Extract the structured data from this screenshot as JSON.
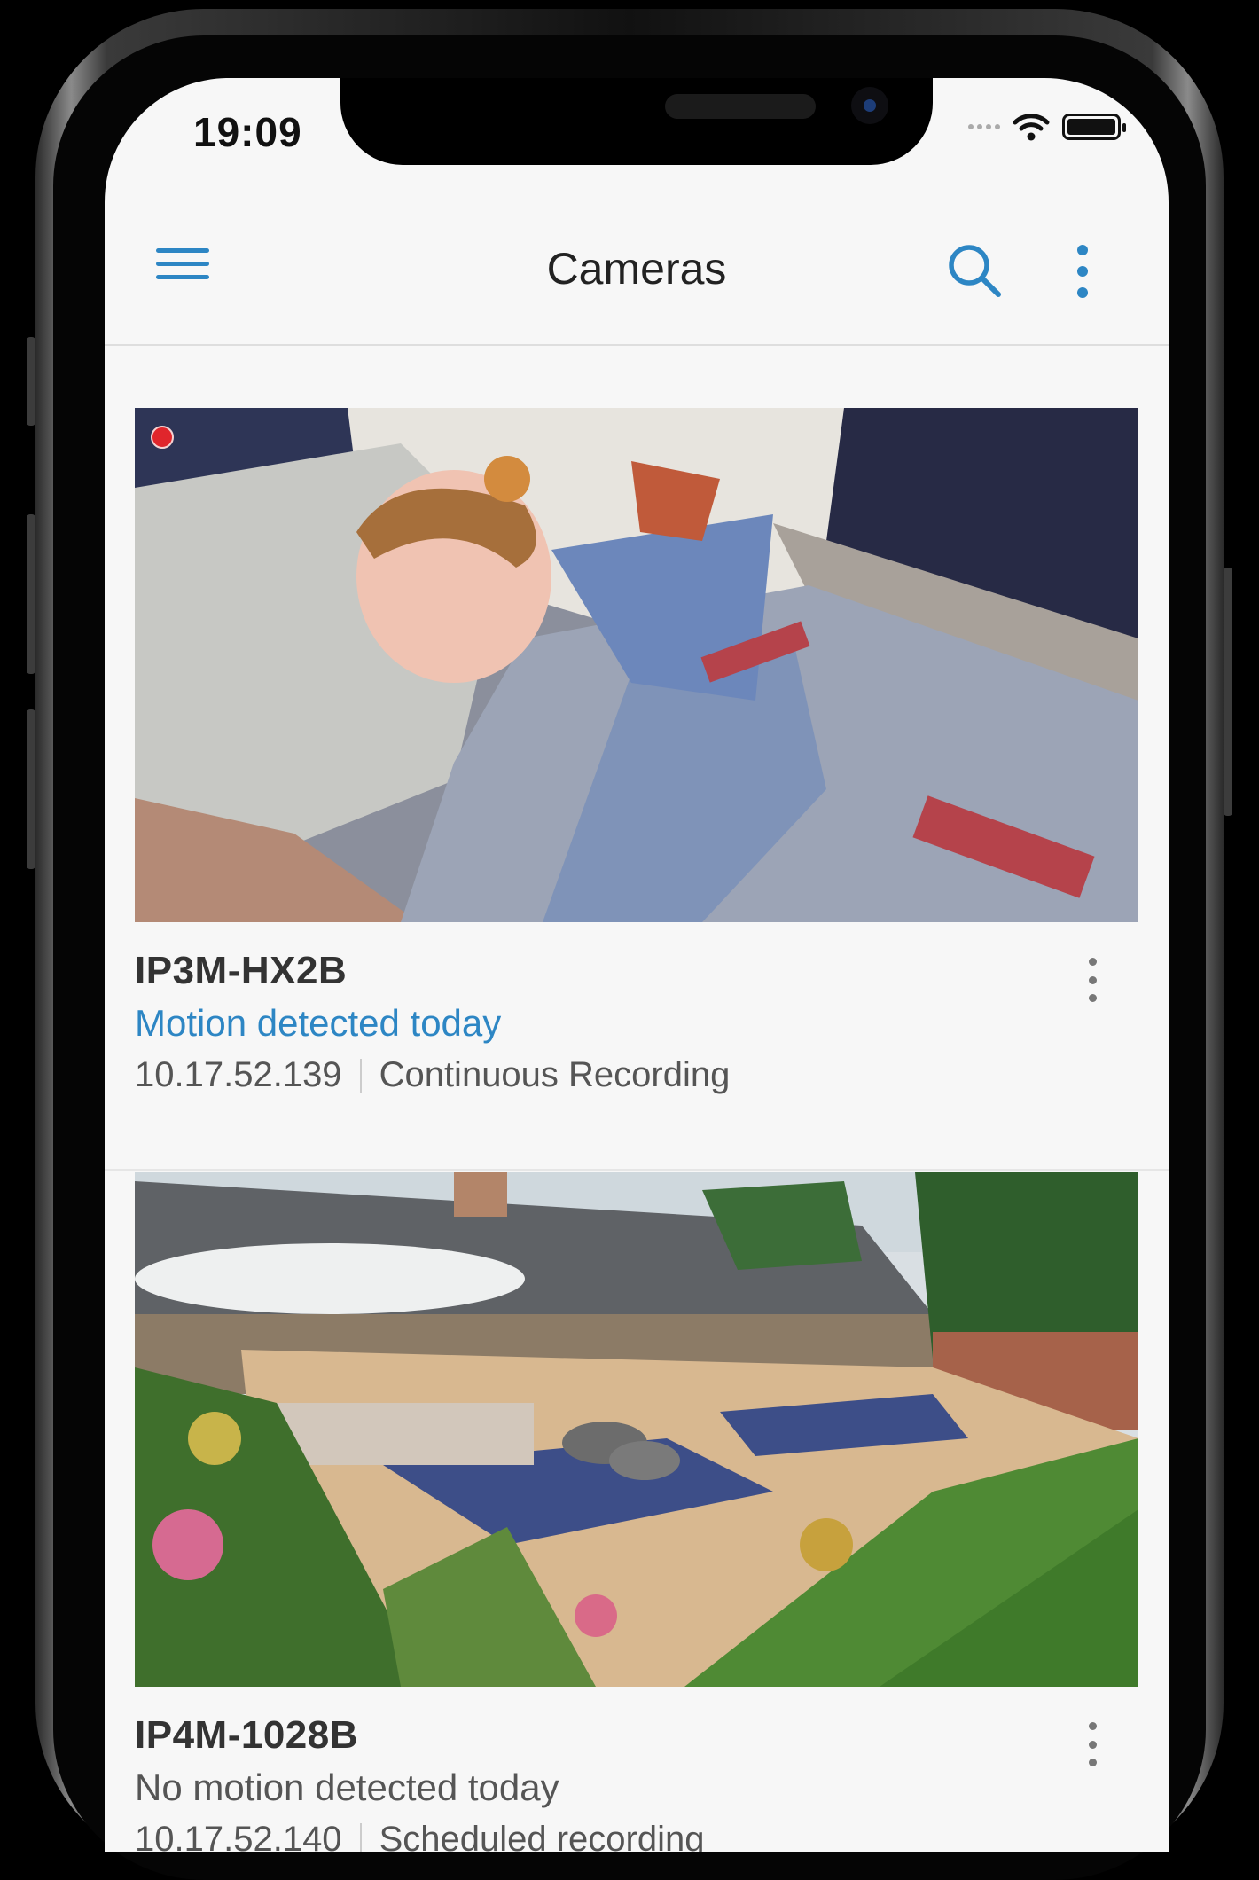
{
  "status_bar": {
    "time": "19:09"
  },
  "appbar": {
    "title": "Cameras"
  },
  "cameras": [
    {
      "name": "IP3M-HX2B",
      "motion": "Motion detected today",
      "ip": "10.17.52.139",
      "mode": "Continuous Recording",
      "recording": true
    },
    {
      "name": "IP4M-1028B",
      "motion": "No motion detected today",
      "ip": "10.17.52.140",
      "mode": "Scheduled recording",
      "recording": false
    }
  ],
  "colors": {
    "accent": "#2d86c4",
    "record": "#e0262c",
    "background": "#f7f7f7"
  },
  "icons": [
    "hamburger-menu-icon",
    "search-icon",
    "more-vertical-icon",
    "wifi-icon",
    "battery-icon",
    "recording-dot-icon"
  ]
}
